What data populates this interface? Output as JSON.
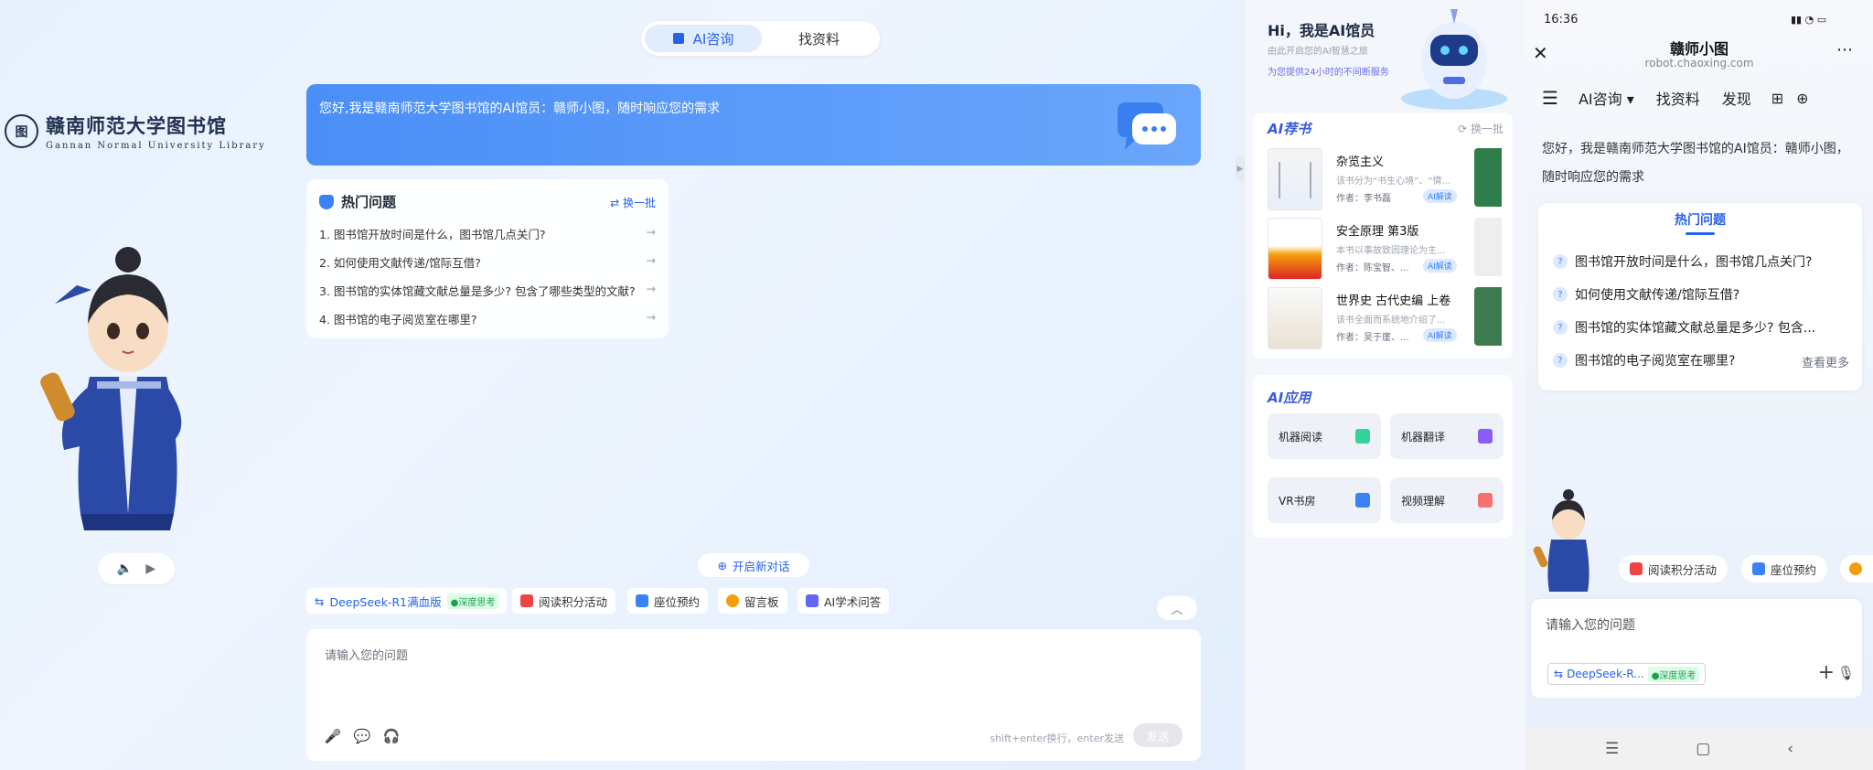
{
  "header": {
    "tab_active": "AI咨询",
    "tab_other": "找资料"
  },
  "logo": {
    "seal": "图",
    "cn": "赣南师范大学图书馆",
    "en": "Gannan Normal University Library"
  },
  "welcome": {
    "text": "您好,我是赣南师范大学图书馆的AI馆员：赣师小图，随时响应您的需求"
  },
  "hot": {
    "title": "热门问题",
    "refresh": "换一批",
    "items": [
      {
        "num": "1.",
        "text": "图书馆开放时间是什么，图书馆几点关门?"
      },
      {
        "num": "2.",
        "text": "如何使用文献传递/馆际互借?"
      },
      {
        "num": "3.",
        "text": "图书馆的实体馆藏文献总量是多少? 包含了哪些类型的文献?"
      },
      {
        "num": "4.",
        "text": "图书馆的电子阅览室在哪里?"
      }
    ]
  },
  "new_chat": "开启新对话",
  "chips": {
    "deepseek": "DeepSeek-R1满血版",
    "deep_badge": "●深度思考",
    "activity": "阅读积分活动",
    "seat": "座位预约",
    "board": "留言板",
    "academic": "AI学术问答"
  },
  "input": {
    "placeholder": "请输入您的问题",
    "hint": "shift+enter换行，enter发送",
    "send": "发送"
  },
  "sidebar": {
    "hi": "Hi，我是AI馆员",
    "sub1": "由此开启您的AI智慧之旅",
    "sub2": "为您提供24小时的不间断服务",
    "rec_title": "AI荐书",
    "rec_refresh": "换一批",
    "books": [
      {
        "title": "杂览主义",
        "desc": "该书分为“书生心境”、“情...",
        "author": "作者：李书磊",
        "tag": "AI解读"
      },
      {
        "title": "安全原理 第3版",
        "desc": "本书以事故致因理论为主...",
        "author": "作者：陈宝智、...",
        "tag": "AI解读"
      },
      {
        "title": "世界史 古代史编 上卷",
        "desc": "该书全面而系统地介绍了...",
        "author": "作者：吴于廑、...",
        "tag": "AI解读"
      }
    ],
    "apps_title": "AI应用",
    "apps": [
      "机器阅读",
      "机器翻译",
      "VR书房",
      "视频理解"
    ]
  },
  "phone": {
    "time": "16:36",
    "title": "赣师小图",
    "url": "robot.chaoxing.com",
    "nav": [
      "AI咨询",
      "找资料",
      "发现"
    ],
    "welcome": "您好，我是赣南师范大学图书馆的AI馆员：赣师小图，随时响应您的需求",
    "hot_title": "热门问题",
    "questions": [
      "图书馆开放时间是什么，图书馆几点关门?",
      "如何使用文献传递/馆际互借?",
      "图书馆的实体馆藏文献总量是多少? 包含...",
      "图书馆的电子阅览室在哪里?"
    ],
    "more": "查看更多",
    "chip_activity": "阅读积分活动",
    "chip_seat": "座位预约",
    "input_placeholder": "请输入您的问题",
    "model": "DeepSeek-R...",
    "model_badge": "●深度思考"
  },
  "colors": {
    "accent": "#2563eb",
    "banner": "#4a8ef7",
    "bg": "#e6f1fd"
  }
}
